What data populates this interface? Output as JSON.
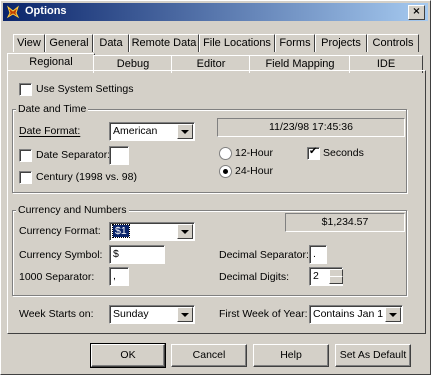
{
  "window": {
    "title": "Options",
    "close_glyph": "×"
  },
  "tabs_row1": [
    "View",
    "General",
    "Data",
    "Remote Data",
    "File Locations",
    "Forms",
    "Projects",
    "Controls"
  ],
  "tabs_row2": [
    "Regional",
    "Debug",
    "Editor",
    "Field Mapping",
    "IDE"
  ],
  "use_system_settings": {
    "label": "Use System Settings",
    "checked": false
  },
  "date_time": {
    "group_title": "Date and Time",
    "date_format_label": "Date Format:",
    "date_format_value": "American",
    "date_separator_label": "Date Separator:",
    "date_separator_value": "",
    "century_label": "Century (1998 vs. 98)",
    "preview": "11/23/98 17:45:36",
    "hour12_label": "12-Hour",
    "hour24_label": "24-Hour",
    "seconds_label": "Seconds"
  },
  "currency_numbers": {
    "group_title": "Currency and Numbers",
    "currency_format_label": "Currency Format:",
    "currency_format_value": "$1",
    "preview": "$1,234.57",
    "currency_symbol_label": "Currency Symbol:",
    "currency_symbol_value": "$",
    "decimal_separator_label": "Decimal Separator:",
    "decimal_separator_value": ".",
    "thousand_separator_label": "1000 Separator:",
    "thousand_separator_value": ",",
    "decimal_digits_label": "Decimal Digits:",
    "decimal_digits_value": "2"
  },
  "week": {
    "week_starts_label": "Week Starts on:",
    "week_starts_value": "Sunday",
    "first_week_label": "First Week of Year:",
    "first_week_value": "Contains Jan 1"
  },
  "buttons": {
    "ok": "OK",
    "cancel": "Cancel",
    "help": "Help",
    "default": "Set As Default"
  }
}
